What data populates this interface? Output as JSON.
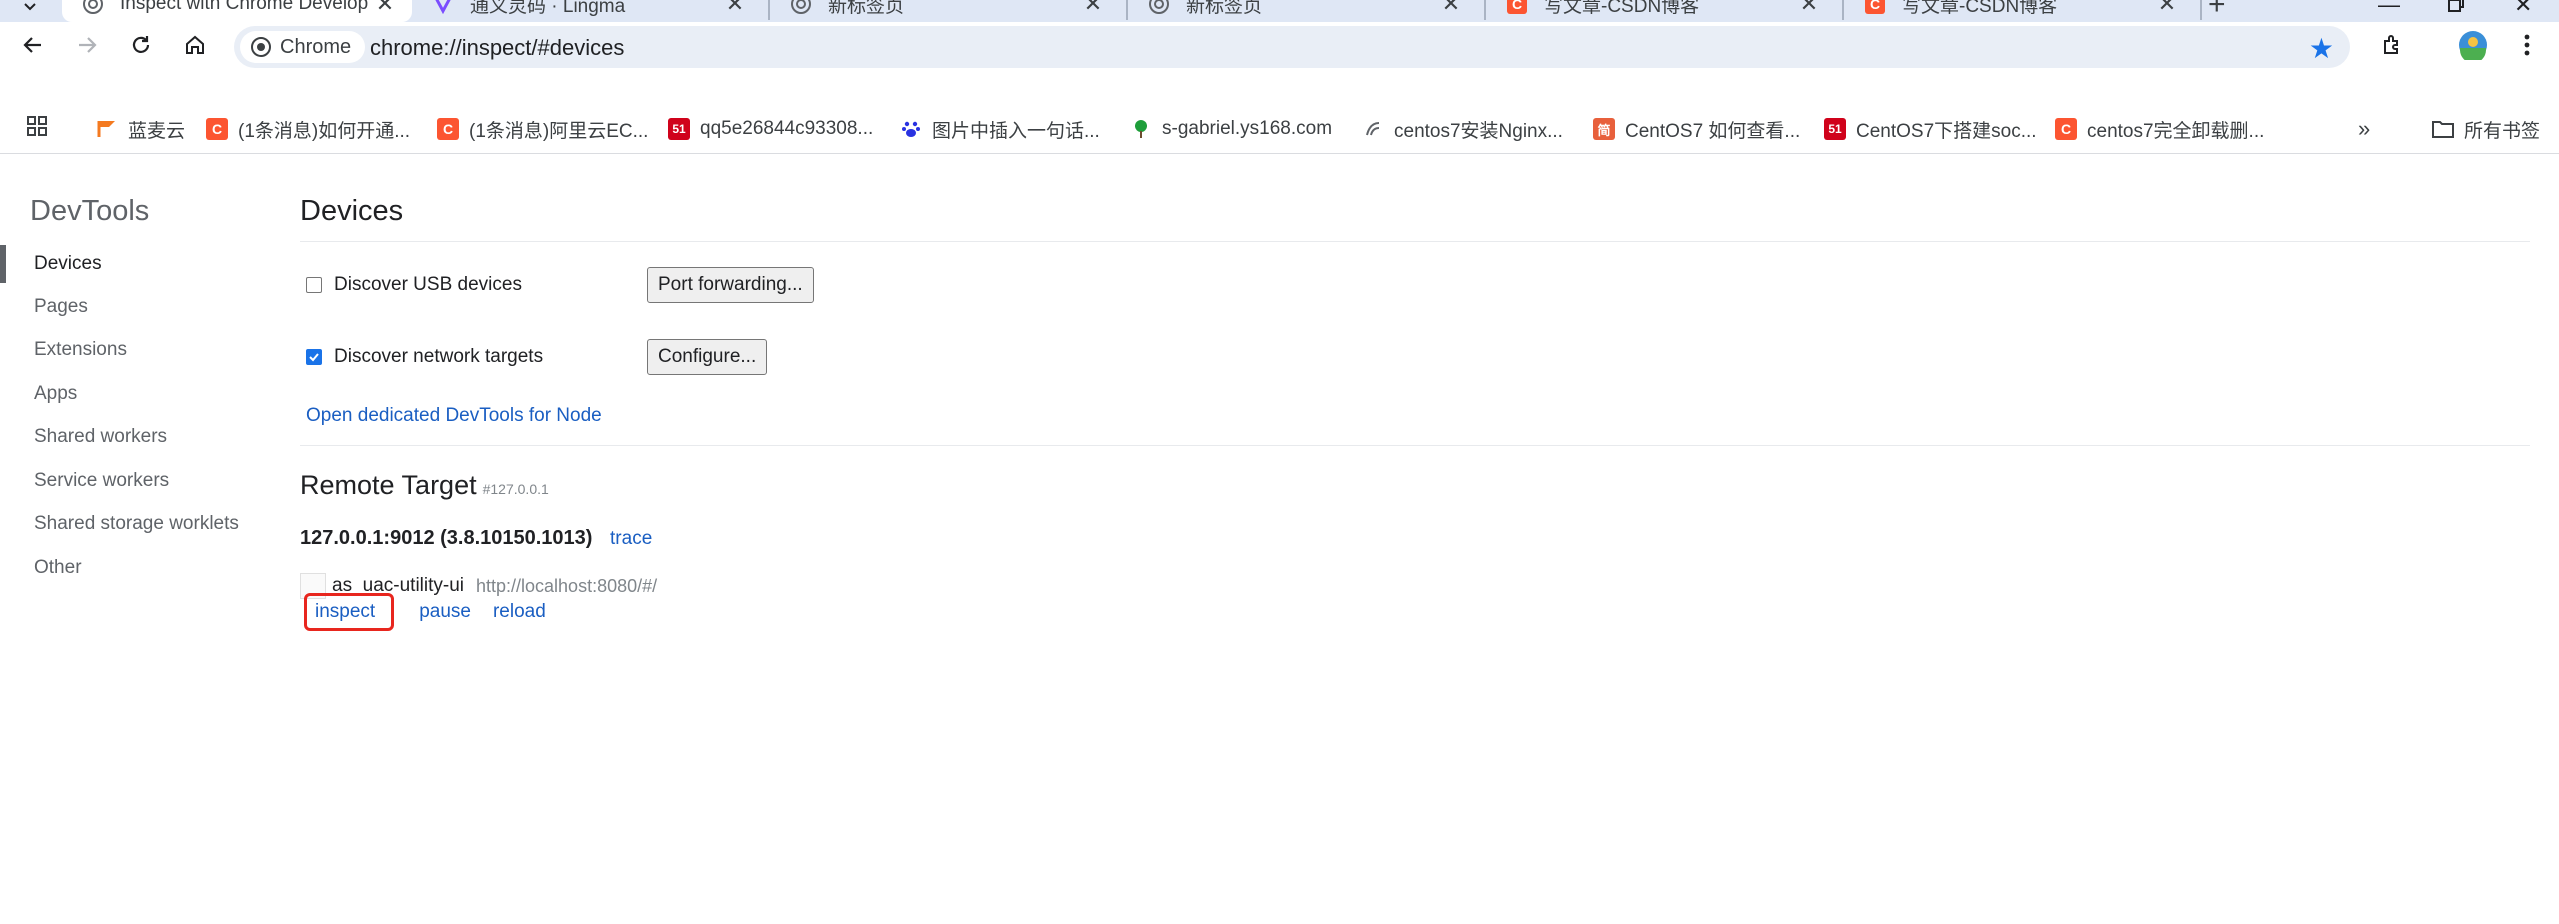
{
  "tabs": [
    {
      "title": "Inspect with Chrome Develop",
      "favicon": "chrome-icon",
      "active": true
    },
    {
      "title": "通义灵码 · Lingma",
      "favicon": "lingma-icon",
      "active": false
    },
    {
      "title": "新标签页",
      "favicon": "chrome-icon",
      "active": false
    },
    {
      "title": "新标签页",
      "favicon": "chrome-icon",
      "active": false
    },
    {
      "title": "写文章-CSDN博客",
      "favicon": "csdn-icon",
      "active": false
    },
    {
      "title": "写文章-CSDN博客",
      "favicon": "csdn-icon",
      "active": false
    }
  ],
  "toolbar": {
    "chip_label": "Chrome",
    "url": "chrome://inspect/#devices"
  },
  "bookmarks": [
    {
      "label": "蓝麦云",
      "icon": "flag-icon"
    },
    {
      "label": "(1条消息)如何开通...",
      "icon": "csdn-icon"
    },
    {
      "label": "(1条消息)阿里云EC...",
      "icon": "csdn-icon"
    },
    {
      "label": "qq5e26844c93308...",
      "icon": "51cto-icon"
    },
    {
      "label": "图片中插入一句话...",
      "icon": "baidu-icon"
    },
    {
      "label": "s-gabriel.ys168.com",
      "icon": "tree-icon"
    },
    {
      "label": "centos7安装Nginx...",
      "icon": "centos-icon"
    },
    {
      "label": "CentOS7 如何查看...",
      "icon": "jianshu-icon"
    },
    {
      "label": "CentOS7下搭建soc...",
      "icon": "51cto-icon"
    },
    {
      "label": "centos7完全卸载删...",
      "icon": "csdn-icon"
    }
  ],
  "bookmarks_all": "所有书签",
  "sidebar": {
    "title": "DevTools",
    "items": [
      "Devices",
      "Pages",
      "Extensions",
      "Apps",
      "Shared workers",
      "Service workers",
      "Shared storage worklets",
      "Other"
    ]
  },
  "main": {
    "title": "Devices",
    "discover_usb": "Discover USB devices",
    "discover_usb_checked": false,
    "port_forwarding_button": "Port forwarding...",
    "discover_network": "Discover network targets",
    "discover_network_checked": true,
    "configure_button": "Configure...",
    "node_link": "Open dedicated DevTools for Node",
    "remote_title": "Remote Target",
    "remote_subtitle": "#127.0.0.1",
    "target_name": "127.0.0.1:9012 (3.8.10150.1013)",
    "trace_link": "trace",
    "page_name": "as_uac-utility-ui",
    "page_url": "http://localhost:8080/#/",
    "inspect_link": "inspect",
    "pause_link": "pause",
    "reload_link": "reload"
  },
  "colors": {
    "tabstrip": "#dfe7f5",
    "link": "#1a5ec2",
    "highlight": "#e8261e",
    "accent": "#1a73e8"
  }
}
